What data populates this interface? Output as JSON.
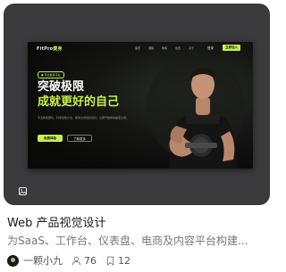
{
  "card": {
    "title": "Web 产品视觉设计",
    "subtitle": "为SaaS、工作台、仪表盘、电商及内容平台构建...",
    "author": "一颗小九",
    "followers": "76",
    "saves": "12"
  },
  "preview": {
    "logo_main": "FitPro",
    "logo_accent": "健身",
    "nav_links": [
      "首页",
      "课程",
      "教练",
      "会员",
      "关于"
    ],
    "login": "登录",
    "nav_cta": "立即加入",
    "tag": "● 专业健身平台",
    "headline_line1": "突破极限",
    "headline_line2": "成就更好的自己",
    "description": "专业教练团队，科学训练方法，助你达成健身目标。立即开始你的蜕变之旅。",
    "primary_button": "免费体验",
    "secondary_button": "了解更多",
    "accent_color": "#c8f04a"
  },
  "icons": {
    "thumbnail_badge": "image-icon",
    "followers": "person-icon",
    "saves": "bookmark-icon"
  }
}
